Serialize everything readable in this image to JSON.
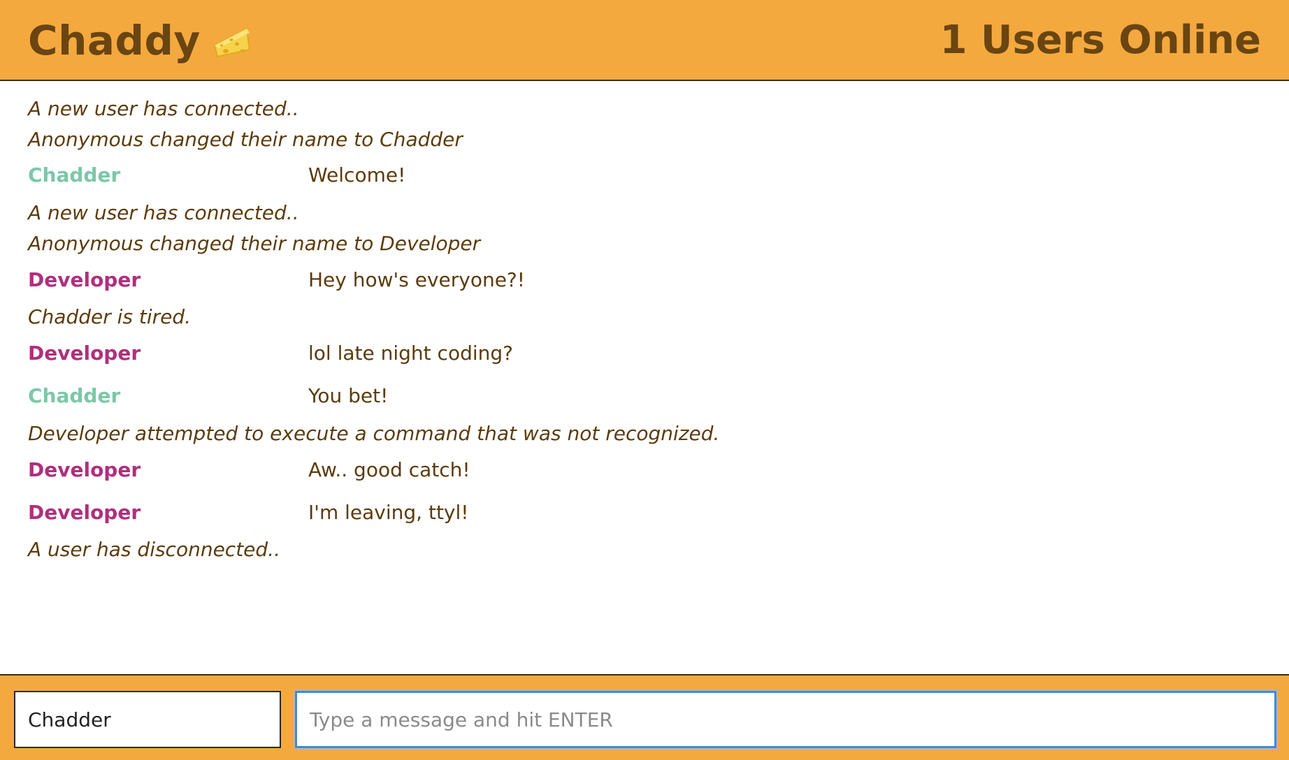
{
  "header": {
    "app_title": "Chaddy",
    "logo_icon": "cheese-icon",
    "users_online": "1 Users Online"
  },
  "messages": [
    {
      "type": "system",
      "text": "A new user has connected.."
    },
    {
      "type": "system",
      "text": "Anonymous changed their name to Chadder"
    },
    {
      "type": "chat",
      "user": "Chadder",
      "text": "Welcome!"
    },
    {
      "type": "system",
      "text": "A new user has connected.."
    },
    {
      "type": "system",
      "text": "Anonymous changed their name to Developer"
    },
    {
      "type": "chat",
      "user": "Developer",
      "text": "Hey how's everyone?!"
    },
    {
      "type": "system",
      "text": "Chadder is tired."
    },
    {
      "type": "chat",
      "user": "Developer",
      "text": "lol late night coding?"
    },
    {
      "type": "chat",
      "user": "Chadder",
      "text": "You bet!"
    },
    {
      "type": "system",
      "text": "Developer attempted to execute a command that was not recognized."
    },
    {
      "type": "chat",
      "user": "Developer",
      "text": "Aw.. good catch!"
    },
    {
      "type": "chat",
      "user": "Developer",
      "text": "I'm leaving, ttyl!"
    },
    {
      "type": "system",
      "text": "A user has disconnected.."
    }
  ],
  "footer": {
    "name_value": "Chadder",
    "message_placeholder": "Type a message and hit ENTER",
    "message_value": ""
  },
  "colors": {
    "brand_orange": "#f4a93f",
    "text_brown": "#5c3b0c",
    "chadder_green": "#7cc7a8",
    "developer_magenta": "#b02f7e",
    "focus_blue": "#4a86d4"
  }
}
